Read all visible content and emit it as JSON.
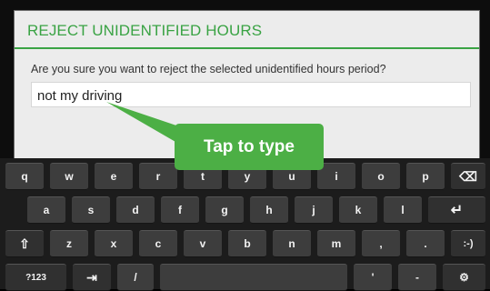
{
  "dialog": {
    "title": "REJECT UNIDENTIFIED HOURS",
    "message": "Are you sure you want to reject the selected unidentified hours period?",
    "input_value": "not my driving"
  },
  "callout": {
    "text": "Tap to type"
  },
  "keyboard": {
    "row1": [
      "q",
      "w",
      "e",
      "r",
      "t",
      "y",
      "u",
      "i",
      "o",
      "p"
    ],
    "row2": [
      "a",
      "s",
      "d",
      "f",
      "g",
      "h",
      "j",
      "k",
      "l"
    ],
    "row3": [
      "z",
      "x",
      "c",
      "v",
      "b",
      "n",
      "m",
      ",",
      "."
    ],
    "symbols_key": "?123",
    "slash_key": "/",
    "apostrophe_key": "'",
    "dash_key": "-",
    "smiley_key": ":-)",
    "shift_icon": "⇧",
    "backspace_icon": "⌫",
    "enter_icon": "↵",
    "tab_icon": "⇥",
    "settings_icon": "⚙"
  },
  "colors": {
    "accent": "#3aa344",
    "callout": "#4caf45"
  }
}
